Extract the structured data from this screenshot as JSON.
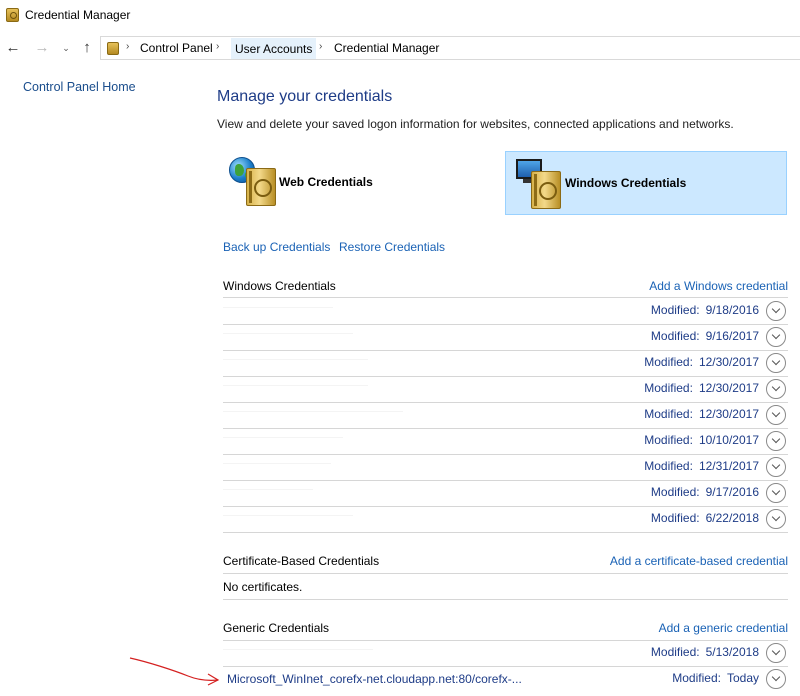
{
  "window": {
    "title": "Credential Manager"
  },
  "nav": {
    "back": "←",
    "forward": "→",
    "recent": "⌄",
    "up": "↑",
    "breadcrumbs": [
      "Control Panel",
      "User Accounts",
      "Credential Manager"
    ],
    "separator": "›"
  },
  "sidebar": {
    "home_link": "Control Panel Home"
  },
  "main": {
    "title": "Manage your credentials",
    "description": "View and delete your saved logon information for websites, connected applications and networks.",
    "tiles": {
      "web": "Web Credentials",
      "windows": "Windows Credentials",
      "selected": "windows"
    },
    "backup_link": "Back up Credentials",
    "restore_link": "Restore Credentials"
  },
  "windows_credentials": {
    "title": "Windows Credentials",
    "add_link": "Add a Windows credential",
    "modified_label": "Modified:",
    "items": [
      {
        "modified": "9/18/2016"
      },
      {
        "modified": "9/16/2017"
      },
      {
        "modified": "12/30/2017"
      },
      {
        "modified": "12/30/2017"
      },
      {
        "modified": "12/30/2017"
      },
      {
        "modified": "10/10/2017"
      },
      {
        "modified": "12/31/2017"
      },
      {
        "modified": "9/17/2016"
      },
      {
        "modified": "6/22/2018"
      }
    ]
  },
  "certificate_credentials": {
    "title": "Certificate-Based Credentials",
    "add_link": "Add a certificate-based credential",
    "empty_text": "No certificates."
  },
  "generic_credentials": {
    "title": "Generic Credentials",
    "add_link": "Add a generic credential",
    "items": [
      {
        "name": "",
        "modified": "5/13/2018"
      },
      {
        "name": "Microsoft_WinInet_corefx-net.cloudapp.net:80/corefx-...",
        "modified": "Today"
      }
    ]
  },
  "colors": {
    "link": "#1a62b5",
    "heading": "#1e3c87",
    "selected_tile": "#cce8ff",
    "annotation_arrow": "#d42020"
  }
}
